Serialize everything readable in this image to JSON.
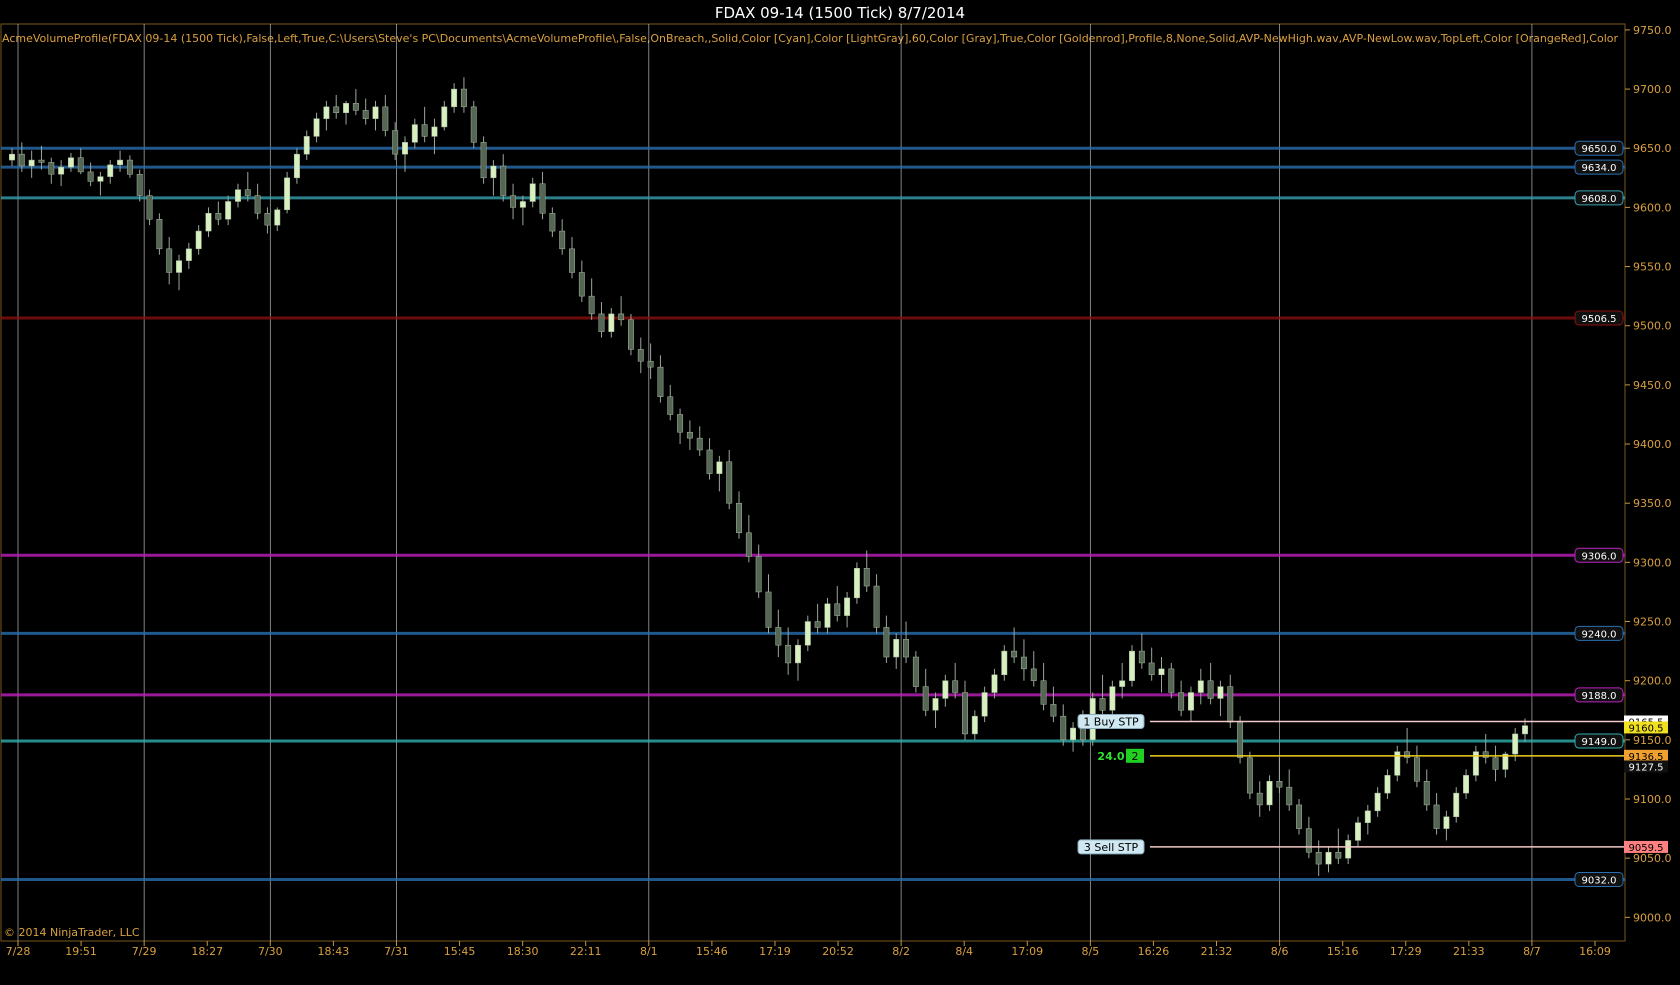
{
  "chart_data": {
    "type": "candlestick",
    "title": "FDAX 09-14 (1500 Tick)  8/7/2014",
    "indicator_label": "AcmeVolumeProfile(FDAX 09-14 (1500 Tick),False,Left,True,C:\\Users\\Steve's PC\\Documents\\AcmeVolumeProfile\\,False,OnBreach,,Solid,Color [Cyan],Color [LightGray],60,Color [Gray],True,Color [Goldenrod],Profile,8,None,Solid,AVP-NewHigh.wav,AVP-NewLow.wav,TopLeft,Color [OrangeRed],Color [DeepSkyBlue],Colo",
    "copyright": "© 2014 NinjaTrader, LLC",
    "ylim": [
      8980,
      9755
    ],
    "y_ticks": [
      "9750.0",
      "9700.0",
      "9650.0",
      "9600.0",
      "9550.0",
      "9500.0",
      "9450.0",
      "9400.0",
      "9350.0",
      "9300.0",
      "9250.0",
      "9200.0",
      "9150.0",
      "9100.0",
      "9050.0",
      "9000.0"
    ],
    "x_ticks": [
      "7/28",
      "19:51",
      "7/29",
      "18:27",
      "7/30",
      "18:43",
      "7/31",
      "15:45",
      "18:30",
      "22:11",
      "8/1",
      "15:46",
      "17:19",
      "20:52",
      "8/2",
      "8/4",
      "17:09",
      "8/5",
      "16:26",
      "21:32",
      "8/6",
      "15:16",
      "17:29",
      "21:33",
      "8/7",
      "16:09"
    ],
    "session_dividers": [
      "7/28",
      "7/29",
      "7/30",
      "7/31",
      "8/1",
      "8/2",
      "8/5",
      "8/6",
      "8/7"
    ],
    "horizontal_levels": [
      {
        "price": 9650.0,
        "label": "9650.0",
        "color": "#2a6fb0"
      },
      {
        "price": 9634.0,
        "label": "9634.0",
        "color": "#2a6fb0"
      },
      {
        "price": 9608.0,
        "label": "9608.0",
        "color": "#38a0b0"
      },
      {
        "price": 9506.5,
        "label": "9506.5",
        "color": "#8a1010"
      },
      {
        "price": 9306.0,
        "label": "9306.0",
        "color": "#c020c0"
      },
      {
        "price": 9240.0,
        "label": "9240.0",
        "color": "#2a6fb0"
      },
      {
        "price": 9188.0,
        "label": "9188.0",
        "color": "#c020c0"
      },
      {
        "price": 9149.0,
        "label": "9149.0",
        "color": "#30b0b0"
      },
      {
        "price": 9032.0,
        "label": "9032.0",
        "color": "#2a6fb0"
      }
    ],
    "price_markers": [
      {
        "price": 9165.5,
        "label": "9165.5",
        "bg": "#ffffff",
        "fg": "#000000"
      },
      {
        "price": 9160.5,
        "label": "9160.5",
        "bg": "#f0e020",
        "fg": "#000000"
      },
      {
        "price": 9136.5,
        "label": "9136.5",
        "bg": "#f0a030",
        "fg": "#000000"
      },
      {
        "price": 9127.5,
        "label": "9127.5",
        "bg": "#101010",
        "fg": "#ffffff"
      },
      {
        "price": 9059.5,
        "label": "9059.5",
        "bg": "#ff8080",
        "fg": "#000000"
      }
    ],
    "orders": [
      {
        "label": "1  Buy STP",
        "price": 9165.5
      },
      {
        "label": "3  Sell STP",
        "price": 9059.5
      }
    ],
    "position": {
      "pnl": "24.0",
      "qty": "2",
      "price": 9136.5
    },
    "candles": [
      [
        9640,
        9650,
        9635,
        9645
      ],
      [
        9645,
        9655,
        9630,
        9635
      ],
      [
        9635,
        9648,
        9625,
        9640
      ],
      [
        9640,
        9652,
        9632,
        9638
      ],
      [
        9638,
        9642,
        9620,
        9628
      ],
      [
        9628,
        9640,
        9618,
        9634
      ],
      [
        9634,
        9646,
        9630,
        9642
      ],
      [
        9642,
        9650,
        9628,
        9630
      ],
      [
        9630,
        9638,
        9618,
        9622
      ],
      [
        9622,
        9630,
        9610,
        9626
      ],
      [
        9626,
        9640,
        9620,
        9636
      ],
      [
        9636,
        9648,
        9630,
        9640
      ],
      [
        9640,
        9644,
        9625,
        9628
      ],
      [
        9628,
        9632,
        9605,
        9610
      ],
      [
        9610,
        9615,
        9585,
        9590
      ],
      [
        9590,
        9595,
        9560,
        9565
      ],
      [
        9565,
        9575,
        9535,
        9545
      ],
      [
        9545,
        9560,
        9530,
        9555
      ],
      [
        9555,
        9570,
        9548,
        9565
      ],
      [
        9565,
        9585,
        9560,
        9580
      ],
      [
        9580,
        9600,
        9575,
        9595
      ],
      [
        9595,
        9605,
        9585,
        9590
      ],
      [
        9590,
        9610,
        9585,
        9605
      ],
      [
        9605,
        9620,
        9600,
        9615
      ],
      [
        9615,
        9630,
        9605,
        9610
      ],
      [
        9610,
        9620,
        9590,
        9595
      ],
      [
        9595,
        9600,
        9578,
        9585
      ],
      [
        9585,
        9600,
        9580,
        9598
      ],
      [
        9598,
        9630,
        9595,
        9625
      ],
      [
        9625,
        9650,
        9620,
        9645
      ],
      [
        9645,
        9665,
        9640,
        9660
      ],
      [
        9660,
        9680,
        9655,
        9675
      ],
      [
        9675,
        9690,
        9665,
        9685
      ],
      [
        9685,
        9695,
        9675,
        9680
      ],
      [
        9680,
        9690,
        9670,
        9688
      ],
      [
        9688,
        9700,
        9678,
        9682
      ],
      [
        9682,
        9692,
        9670,
        9675
      ],
      [
        9675,
        9690,
        9665,
        9685
      ],
      [
        9685,
        9695,
        9660,
        9665
      ],
      [
        9665,
        9672,
        9640,
        9645
      ],
      [
        9645,
        9660,
        9630,
        9655
      ],
      [
        9655,
        9675,
        9650,
        9670
      ],
      [
        9670,
        9685,
        9655,
        9660
      ],
      [
        9660,
        9675,
        9645,
        9668
      ],
      [
        9668,
        9690,
        9665,
        9685
      ],
      [
        9685,
        9705,
        9680,
        9700
      ],
      [
        9700,
        9710,
        9680,
        9685
      ],
      [
        9685,
        9690,
        9650,
        9655
      ],
      [
        9655,
        9660,
        9620,
        9625
      ],
      [
        9625,
        9640,
        9610,
        9635
      ],
      [
        9635,
        9645,
        9605,
        9610
      ],
      [
        9610,
        9620,
        9590,
        9600
      ],
      [
        9600,
        9610,
        9585,
        9605
      ],
      [
        9605,
        9625,
        9600,
        9620
      ],
      [
        9620,
        9630,
        9590,
        9595
      ],
      [
        9595,
        9600,
        9575,
        9580
      ],
      [
        9580,
        9590,
        9560,
        9565
      ],
      [
        9565,
        9575,
        9540,
        9545
      ],
      [
        9545,
        9555,
        9520,
        9525
      ],
      [
        9525,
        9540,
        9505,
        9510
      ],
      [
        9510,
        9520,
        9490,
        9495
      ],
      [
        9495,
        9515,
        9490,
        9510
      ],
      [
        9510,
        9525,
        9500,
        9505
      ],
      [
        9505,
        9510,
        9475,
        9480
      ],
      [
        9480,
        9490,
        9460,
        9470
      ],
      [
        9470,
        9485,
        9455,
        9465
      ],
      [
        9465,
        9475,
        9435,
        9440
      ],
      [
        9440,
        9450,
        9420,
        9425
      ],
      [
        9425,
        9430,
        9400,
        9410
      ],
      [
        9410,
        9420,
        9395,
        9405
      ],
      [
        9405,
        9415,
        9390,
        9395
      ],
      [
        9395,
        9405,
        9370,
        9375
      ],
      [
        9375,
        9390,
        9360,
        9385
      ],
      [
        9385,
        9395,
        9345,
        9350
      ],
      [
        9350,
        9360,
        9320,
        9325
      ],
      [
        9325,
        9340,
        9300,
        9305
      ],
      [
        9305,
        9315,
        9270,
        9275
      ],
      [
        9275,
        9290,
        9240,
        9245
      ],
      [
        9245,
        9260,
        9220,
        9230
      ],
      [
        9230,
        9245,
        9205,
        9215
      ],
      [
        9215,
        9235,
        9200,
        9230
      ],
      [
        9230,
        9255,
        9225,
        9250
      ],
      [
        9250,
        9265,
        9240,
        9245
      ],
      [
        9245,
        9270,
        9240,
        9265
      ],
      [
        9265,
        9280,
        9250,
        9255
      ],
      [
        9255,
        9275,
        9245,
        9270
      ],
      [
        9270,
        9300,
        9265,
        9295
      ],
      [
        9295,
        9310,
        9275,
        9280
      ],
      [
        9280,
        9290,
        9240,
        9245
      ],
      [
        9245,
        9255,
        9215,
        9220
      ],
      [
        9220,
        9240,
        9210,
        9235
      ],
      [
        9235,
        9250,
        9215,
        9220
      ],
      [
        9220,
        9225,
        9190,
        9195
      ],
      [
        9195,
        9210,
        9170,
        9175
      ],
      [
        9175,
        9190,
        9160,
        9185
      ],
      [
        9185,
        9205,
        9178,
        9200
      ],
      [
        9200,
        9215,
        9185,
        9190
      ],
      [
        9190,
        9200,
        9150,
        9155
      ],
      [
        9155,
        9175,
        9150,
        9170
      ],
      [
        9170,
        9195,
        9165,
        9190
      ],
      [
        9190,
        9210,
        9185,
        9205
      ],
      [
        9205,
        9230,
        9200,
        9225
      ],
      [
        9225,
        9245,
        9215,
        9220
      ],
      [
        9220,
        9235,
        9200,
        9210
      ],
      [
        9210,
        9225,
        9195,
        9200
      ],
      [
        9200,
        9215,
        9175,
        9180
      ],
      [
        9180,
        9195,
        9165,
        9170
      ],
      [
        9170,
        9180,
        9145,
        9150
      ],
      [
        9150,
        9165,
        9140,
        9160
      ],
      [
        9160,
        9175,
        9145,
        9150
      ],
      [
        9150,
        9190,
        9145,
        9185
      ],
      [
        9185,
        9205,
        9170,
        9175
      ],
      [
        9175,
        9200,
        9170,
        9195
      ],
      [
        9195,
        9215,
        9185,
        9200
      ],
      [
        9200,
        9230,
        9195,
        9225
      ],
      [
        9225,
        9240,
        9210,
        9215
      ],
      [
        9215,
        9228,
        9200,
        9205
      ],
      [
        9205,
        9220,
        9190,
        9210
      ],
      [
        9210,
        9215,
        9185,
        9190
      ],
      [
        9190,
        9200,
        9170,
        9175
      ],
      [
        9175,
        9195,
        9165,
        9190
      ],
      [
        9190,
        9210,
        9180,
        9200
      ],
      [
        9200,
        9215,
        9180,
        9185
      ],
      [
        9185,
        9200,
        9170,
        9195
      ],
      [
        9195,
        9205,
        9160,
        9165
      ],
      [
        9165,
        9170,
        9130,
        9135
      ],
      [
        9135,
        9140,
        9100,
        9105
      ],
      [
        9105,
        9115,
        9085,
        9095
      ],
      [
        9095,
        9120,
        9090,
        9115
      ],
      [
        9115,
        9135,
        9105,
        9110
      ],
      [
        9110,
        9125,
        9090,
        9095
      ],
      [
        9095,
        9100,
        9070,
        9075
      ],
      [
        9075,
        9085,
        9050,
        9055
      ],
      [
        9055,
        9065,
        9035,
        9045
      ],
      [
        9045,
        9060,
        9038,
        9055
      ],
      [
        9055,
        9075,
        9045,
        9050
      ],
      [
        9050,
        9070,
        9045,
        9065
      ],
      [
        9065,
        9085,
        9060,
        9080
      ],
      [
        9080,
        9095,
        9070,
        9090
      ],
      [
        9090,
        9110,
        9085,
        9105
      ],
      [
        9105,
        9125,
        9100,
        9120
      ],
      [
        9120,
        9145,
        9115,
        9140
      ],
      [
        9140,
        9160,
        9130,
        9135
      ],
      [
        9135,
        9145,
        9110,
        9115
      ],
      [
        9115,
        9125,
        9090,
        9095
      ],
      [
        9095,
        9105,
        9070,
        9075
      ],
      [
        9075,
        9090,
        9065,
        9085
      ],
      [
        9085,
        9110,
        9080,
        9105
      ],
      [
        9105,
        9125,
        9100,
        9120
      ],
      [
        9120,
        9145,
        9115,
        9140
      ],
      [
        9140,
        9155,
        9130,
        9135
      ],
      [
        9135,
        9145,
        9115,
        9125
      ],
      [
        9125,
        9140,
        9118,
        9138
      ],
      [
        9138,
        9160,
        9132,
        9155
      ],
      [
        9155,
        9168,
        9148,
        9162
      ]
    ],
    "legend": "none",
    "grid": false
  }
}
